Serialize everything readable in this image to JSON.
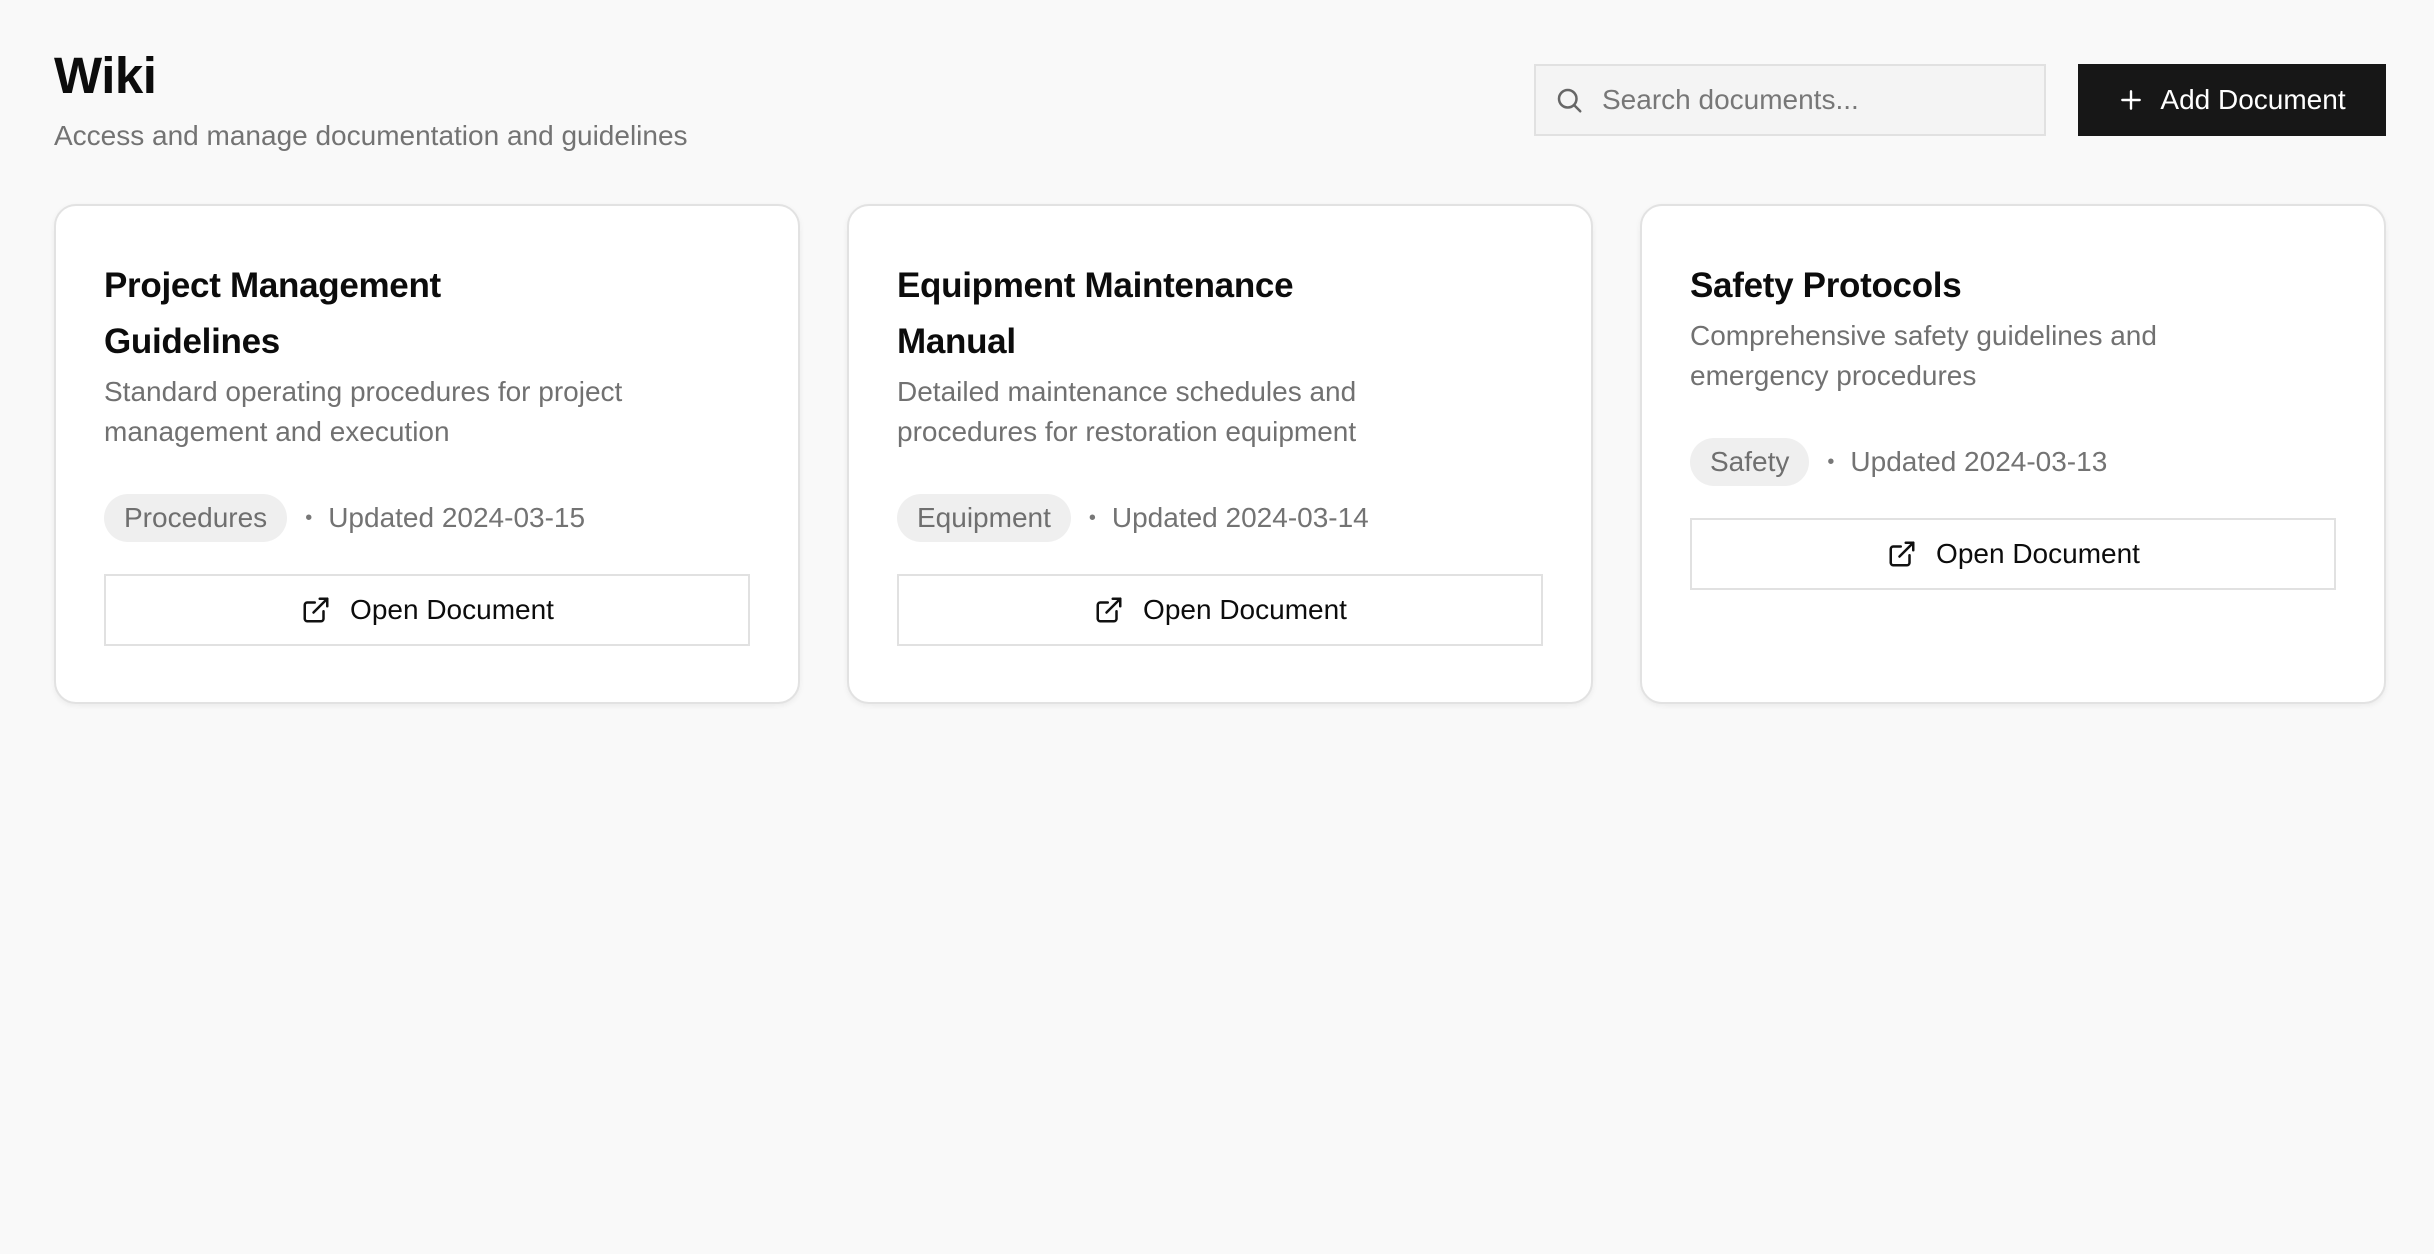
{
  "header": {
    "title": "Wiki",
    "subtitle": "Access and manage documentation and guidelines"
  },
  "search": {
    "placeholder": "Search documents...",
    "value": "",
    "icon": "search-icon"
  },
  "add_button": {
    "label": "Add Document",
    "icon": "plus-icon"
  },
  "documents": [
    {
      "title": "Project Management Guidelines",
      "description": "Standard operating procedures for project management and execution",
      "tag": "Procedures",
      "updated": "Updated 2024-03-15",
      "button_label": "Open Document",
      "button_icon": "external-link-icon"
    },
    {
      "title": "Equipment Maintenance Manual",
      "description": "Detailed maintenance schedules and procedures for restoration equipment",
      "tag": "Equipment",
      "updated": "Updated 2024-03-14",
      "button_label": "Open Document",
      "button_icon": "external-link-icon"
    },
    {
      "title": "Safety Protocols",
      "description": "Comprehensive safety guidelines and emergency procedures",
      "tag": "Safety",
      "updated": "Updated 2024-03-13",
      "button_label": "Open Document",
      "button_icon": "external-link-icon"
    }
  ],
  "colors": {
    "background": "#f9f9f9",
    "primary_button": "#171717",
    "card_background": "#ffffff",
    "muted_text": "#737373",
    "tag_background": "#efefef"
  },
  "meta_separator": "•"
}
